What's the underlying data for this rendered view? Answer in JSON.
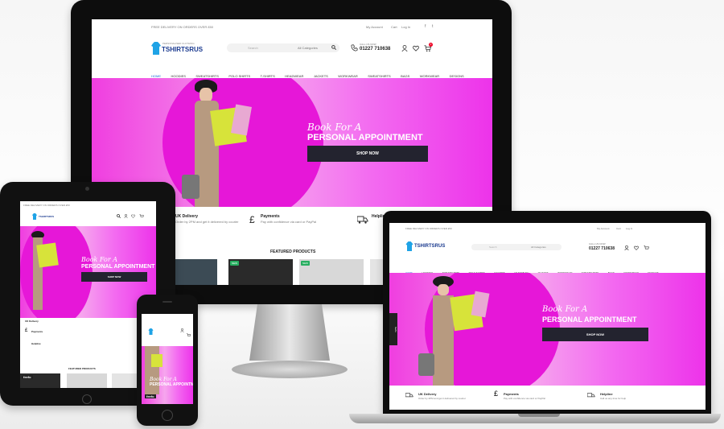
{
  "topbar": {
    "free_delivery": "FREE DELIVERY ON ORDERS OVER £50",
    "my_account": "My Account",
    "cart": "Cart",
    "login": "Log In"
  },
  "header": {
    "logo_text": "TSHIRTSRUS",
    "logo_subtext": "PERSONALISED CLOTHING",
    "search_placeholder": "Search",
    "category_label": "All Categories",
    "phone_label": "CALL US NOW",
    "phone_number": "01227 710638",
    "cart_count": "0"
  },
  "nav": {
    "items": [
      "HOME",
      "HOODIES",
      "SWEATSHIRTS",
      "POLO SHIRTS",
      "T-SHIRTS",
      "HEADWEAR",
      "JACKETS",
      "WORKWEAR",
      "SWEATSHIRTS",
      "BAGS",
      "WORKWEAR",
      "DESIGNS"
    ]
  },
  "hero": {
    "line1": "Book For A",
    "line2": "PERSONAL APPOINTMENT",
    "button": "SHOP NOW"
  },
  "features": {
    "delivery_title": "UK Delivery",
    "delivery_text": "Order by 2PM and get it delivered by courier",
    "payments_title": "Payments",
    "payments_text": "Pay with confidence via card or PayPal",
    "help_title": "Helpline",
    "help_text": "Call us any time for help"
  },
  "featured": {
    "title": "FEATURED PRODUCTS",
    "badge": "NEW"
  },
  "feedback_tab": "feefo",
  "colors": {
    "pink": "#ee2fe2",
    "dark": "#23232f",
    "accent": "#e617d8"
  }
}
